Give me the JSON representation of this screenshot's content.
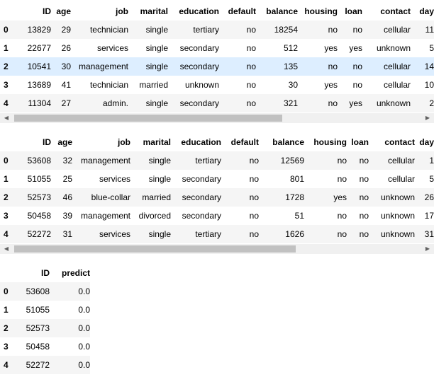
{
  "table1": {
    "columns": [
      "",
      "ID",
      "age",
      "job",
      "marital",
      "education",
      "default",
      "balance",
      "housing",
      "loan",
      "contact",
      "day"
    ],
    "rows": [
      [
        "0",
        "13829",
        "29",
        "technician",
        "single",
        "tertiary",
        "no",
        "18254",
        "no",
        "no",
        "cellular",
        "11"
      ],
      [
        "1",
        "22677",
        "26",
        "services",
        "single",
        "secondary",
        "no",
        "512",
        "yes",
        "yes",
        "unknown",
        "5"
      ],
      [
        "2",
        "10541",
        "30",
        "management",
        "single",
        "secondary",
        "no",
        "135",
        "no",
        "no",
        "cellular",
        "14"
      ],
      [
        "3",
        "13689",
        "41",
        "technician",
        "married",
        "unknown",
        "no",
        "30",
        "yes",
        "no",
        "cellular",
        "10"
      ],
      [
        "4",
        "11304",
        "27",
        "admin.",
        "single",
        "secondary",
        "no",
        "321",
        "no",
        "yes",
        "unknown",
        "2"
      ]
    ],
    "highlight_row": 2
  },
  "table2": {
    "columns": [
      "",
      "ID",
      "age",
      "job",
      "marital",
      "education",
      "default",
      "balance",
      "housing",
      "loan",
      "contact",
      "day"
    ],
    "rows": [
      [
        "0",
        "53608",
        "32",
        "management",
        "single",
        "tertiary",
        "no",
        "12569",
        "no",
        "no",
        "cellular",
        "1"
      ],
      [
        "1",
        "51055",
        "25",
        "services",
        "single",
        "secondary",
        "no",
        "801",
        "no",
        "no",
        "cellular",
        "5"
      ],
      [
        "2",
        "52573",
        "46",
        "blue-collar",
        "married",
        "secondary",
        "no",
        "1728",
        "yes",
        "no",
        "unknown",
        "26"
      ],
      [
        "3",
        "50458",
        "39",
        "management",
        "divorced",
        "secondary",
        "no",
        "51",
        "no",
        "no",
        "unknown",
        "17"
      ],
      [
        "4",
        "52272",
        "31",
        "services",
        "single",
        "tertiary",
        "no",
        "1626",
        "no",
        "no",
        "unknown",
        "31"
      ]
    ]
  },
  "table3": {
    "columns": [
      "",
      "ID",
      "predict"
    ],
    "rows": [
      [
        "0",
        "53608",
        "0.0"
      ],
      [
        "1",
        "51055",
        "0.0"
      ],
      [
        "2",
        "52573",
        "0.0"
      ],
      [
        "3",
        "50458",
        "0.0"
      ],
      [
        "4",
        "52272",
        "0.0"
      ]
    ]
  },
  "icons": {
    "scroll_left": "arrow-left-icon",
    "scroll_right": "arrow-right-icon"
  },
  "colors": {
    "row_stripe": "#f5f5f5",
    "row_hover": "#ddeeff",
    "scroll_track": "#f0f0f0",
    "scroll_thumb": "#c1c1c1"
  }
}
